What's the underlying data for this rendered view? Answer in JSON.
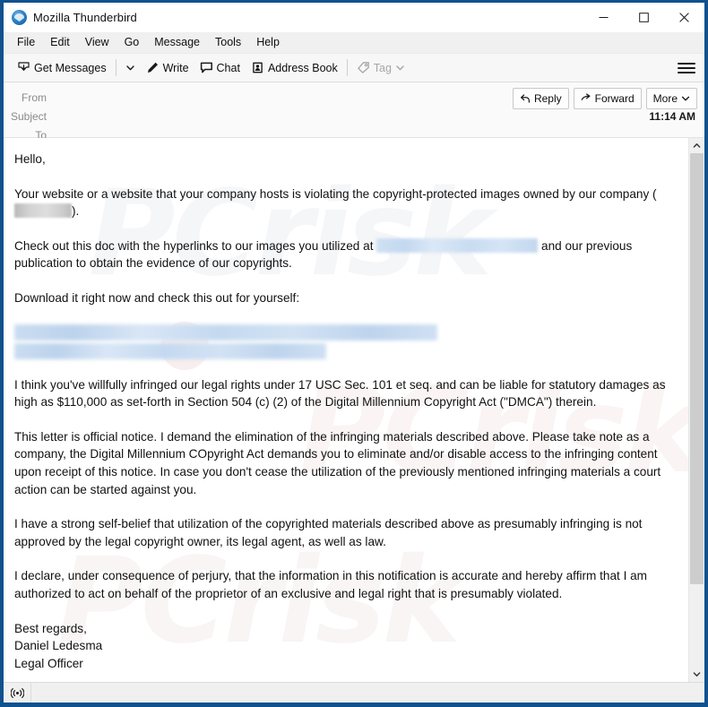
{
  "window": {
    "title": "Mozilla Thunderbird",
    "app_icon": "thunderbird-logo-icon",
    "controls": {
      "minimize": "minimize-icon",
      "maximize": "maximize-icon",
      "close": "close-icon"
    }
  },
  "menubar": {
    "items": [
      {
        "label": "File"
      },
      {
        "label": "Edit"
      },
      {
        "label": "View"
      },
      {
        "label": "Go"
      },
      {
        "label": "Message"
      },
      {
        "label": "Tools"
      },
      {
        "label": "Help"
      }
    ]
  },
  "toolbar": {
    "get_messages": "Get Messages",
    "get_messages_icon": "inbox-download-icon",
    "get_messages_dropdown_icon": "chevron-down-icon",
    "write": "Write",
    "write_icon": "pencil-icon",
    "chat": "Chat",
    "chat_icon": "speech-bubble-icon",
    "address_book": "Address Book",
    "address_book_icon": "address-book-icon",
    "tag": "Tag",
    "tag_icon": "tag-icon",
    "tag_dropdown_icon": "chevron-down-icon",
    "tag_disabled": true,
    "app_menu_icon": "hamburger-menu-icon"
  },
  "message_header": {
    "from_label": "From",
    "from_value": "",
    "subject_label": "Subject",
    "subject_value": "",
    "to_label": "To",
    "to_value": "",
    "time": "11:14 AM",
    "actions": {
      "reply": "Reply",
      "reply_icon": "reply-arrow-icon",
      "forward": "Forward",
      "forward_icon": "forward-arrow-icon",
      "more": "More",
      "more_icon": "chevron-down-icon"
    }
  },
  "message_body": {
    "greeting": "Hello,",
    "p1_before": "Your website or a website that your company hosts is violating the copyright-protected images owned by our company (",
    "p1_after": ").",
    "p2_before": "Check out this doc with the hyperlinks to our images you utilized at",
    "p2_after": "and our previous publication to obtain the evidence of our copyrights.",
    "p3": "Download it right now and check this out for yourself:",
    "p4": "I think you've willfully infringed our legal rights under 17 USC Sec. 101 et seq. and can be liable for statutory damages as high as $110,000 as set-forth in Section 504 (c) (2) of the Digital Millennium Copyright Act (\"DMCA\") therein.",
    "p5": "This letter is official notice. I demand the elimination of the infringing materials described above. Please take note as a company, the Digital Millennium COpyright Act demands you to eliminate and/or disable access to the infringing content upon receipt of this notice. In case you don't cease the utilization of the previously mentioned infringing materials a court action can be started against you.",
    "p6": "I have a strong self-belief that utilization of the copyrighted materials described above as presumably infringing is not approved by the legal copyright owner, its legal agent, as well as law.",
    "p7": "I declare, under consequence of perjury, that the information in this notification is accurate and hereby affirm that I am authorized to act on behalf of the proprietor of an exclusive and legal right that is presumably violated.",
    "sign_off": "Best regards,",
    "sender_name": "Daniel Ledesma",
    "sender_title": "Legal Officer",
    "redactions": {
      "company_name": "redacted-gray-block",
      "inline_link": "redacted-blue-block",
      "download_link": "redacted-blue-link-block"
    },
    "watermark_text": "PCrisk"
  },
  "scrollbar": {
    "up_icon": "chevron-up-icon",
    "down_icon": "chevron-down-icon",
    "thumb": "scroll-thumb"
  },
  "statusbar": {
    "icon": "broadcast-icon",
    "text": ""
  },
  "colors": {
    "window_border": "#10518f",
    "toolbar_bg": "#f7f7f7",
    "menubar_bg": "#f0f0f0",
    "header_bg": "#fafafa",
    "body_bg": "#ffffff",
    "text": "#111111",
    "muted_label": "#8a8a8a",
    "redact_blue": "#c8dcf1",
    "redact_gray": "#cfcfcf"
  }
}
